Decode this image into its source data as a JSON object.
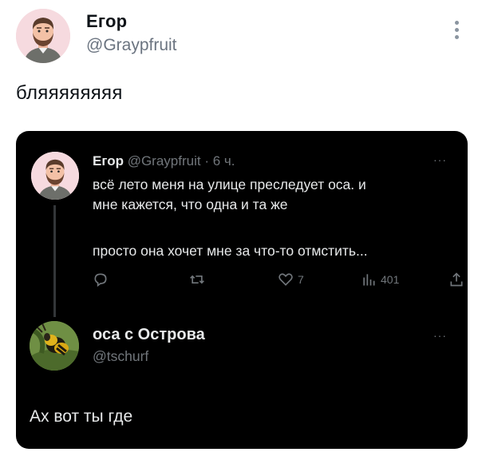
{
  "outer_tweet": {
    "name": "Егор",
    "handle": "@Graypfruit",
    "text": "бляяяяяяяя"
  },
  "quoted_tweet": {
    "name": "Егор",
    "handle_time": "@Graypfruit · 6 ч.",
    "more": "···",
    "body_line1": "всё лето меня на улице преследует оса. и",
    "body_line2": "мне кажется, что одна и та же",
    "body_line3": "просто она хочет мне за что-то отмстить...",
    "likes": "7",
    "views": "401"
  },
  "reply": {
    "name": "оса с Острова",
    "handle": "@tschurf",
    "more": "···",
    "text": "Ах вот ты где"
  },
  "colors": {
    "dark_bg": "#000000",
    "dark_text": "#e7e9ea",
    "muted": "#71767b",
    "avatar_bg": "#f3d8dc"
  },
  "icons": [
    "more-vertical-icon",
    "reply-icon",
    "retweet-icon",
    "like-icon",
    "views-icon",
    "share-icon"
  ]
}
